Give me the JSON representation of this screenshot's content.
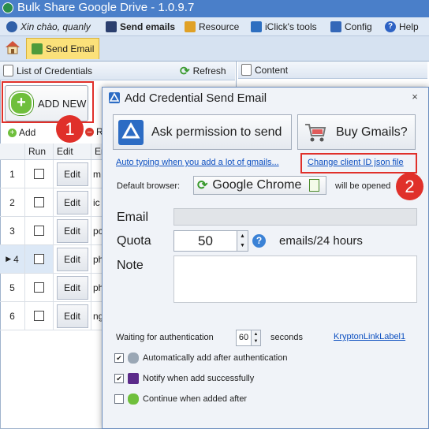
{
  "window": {
    "title": "Bulk Share Google Drive - 1.0.9.7"
  },
  "menu": {
    "greeting": "Xin chào, quanly",
    "send_emails": "Send emails",
    "resource": "Resource",
    "iclick_tools": "iClick's tools",
    "config": "Config",
    "help": "Help"
  },
  "tabs": {
    "send_email": "Send Email"
  },
  "left_panel": {
    "header": "List of Credentials",
    "refresh": "Refresh",
    "add_new": "ADD NEW",
    "toolbar_add": "Add",
    "toolbar_r": "R",
    "grid": {
      "columns": [
        "",
        "Run",
        "Edit",
        "En"
      ],
      "rows": [
        {
          "num": "1",
          "edit": "Edit",
          "email": "m"
        },
        {
          "num": "2",
          "edit": "Edit",
          "email": "ic"
        },
        {
          "num": "3",
          "edit": "Edit",
          "email": "pc"
        },
        {
          "num": "4",
          "edit": "Edit",
          "email": "ph"
        },
        {
          "num": "5",
          "edit": "Edit",
          "email": "ph"
        },
        {
          "num": "6",
          "edit": "Edit",
          "email": "ng"
        }
      ]
    }
  },
  "right_panel": {
    "content_tab": "Content"
  },
  "annotations": {
    "badge1": "1",
    "badge2": "2"
  },
  "dialog": {
    "title": "Add Credential Send Email",
    "close": "×",
    "ask_permission": "Ask permission to send",
    "buy_gmails": "Buy Gmails?",
    "auto_typing_link": "Auto typing when you add a lot of gmails...",
    "change_client_link": "Change client ID json file",
    "default_browser_label": "Default browser:",
    "browser_value": "Google Chrome",
    "opened_label": "will be opened",
    "email_label": "Email",
    "email_value": "",
    "quota_label": "Quota",
    "quota_value": "50",
    "quota_unit": "emails/24 hours",
    "note_label": "Note",
    "note_value": "",
    "wait_label": "Waiting for authentication",
    "wait_value": "60",
    "wait_unit": "seconds",
    "krypton_link": "KryptonLinkLabel1",
    "opt_auto_add": "Automatically add after authentication",
    "opt_auto_add_checked": true,
    "opt_notify": "Notify when add successfully",
    "opt_notify_checked": true,
    "opt_continue": "Continue when added after",
    "opt_continue_checked": false
  },
  "colors": {
    "title_bar": "#4a7fc9",
    "accent_tab": "#fbe17a",
    "annotation_red": "#e0302a",
    "link": "#0c4fc0"
  }
}
